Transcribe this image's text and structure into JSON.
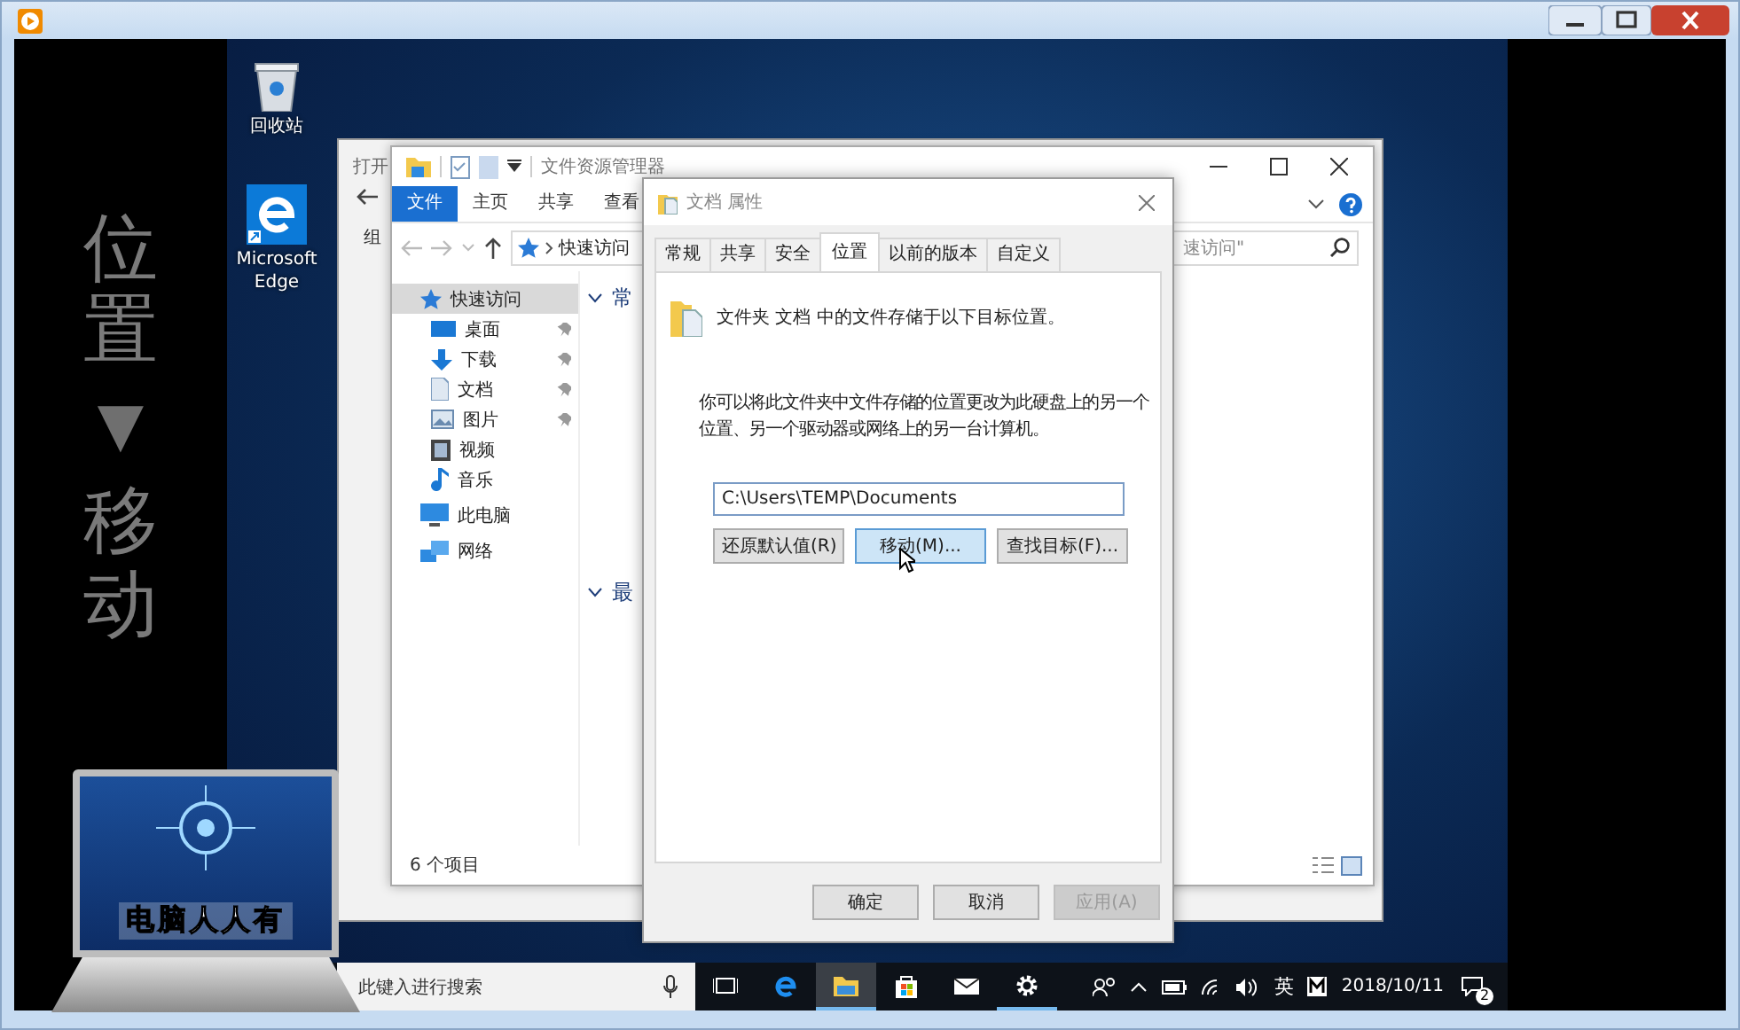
{
  "caption": {
    "top": "位置",
    "arrow": "▼",
    "bottom": "移动"
  },
  "desktop_icons": [
    {
      "kind": "recycle-bin",
      "label": "回收站"
    },
    {
      "kind": "edge",
      "label": "Microsoft Edge"
    }
  ],
  "back_window": {
    "title": "打开",
    "toolbar_text": "组"
  },
  "explorer": {
    "title": "文件资源管理器",
    "ribbon_tabs": [
      {
        "label": "文件",
        "selected": true
      },
      {
        "label": "主页",
        "selected": false
      },
      {
        "label": "共享",
        "selected": false
      },
      {
        "label": "查看",
        "selected": false
      }
    ],
    "address": "快速访问",
    "search_placeholder": "速访问\"",
    "nav": [
      {
        "kind": "star",
        "label": "快速访问",
        "selected": true,
        "children": [
          {
            "kind": "desktop",
            "label": "桌面",
            "pinned": true
          },
          {
            "kind": "download",
            "label": "下载",
            "pinned": true
          },
          {
            "kind": "document",
            "label": "文档",
            "pinned": true
          },
          {
            "kind": "picture",
            "label": "图片",
            "pinned": true
          },
          {
            "kind": "video",
            "label": "视频",
            "pinned": false
          },
          {
            "kind": "music",
            "label": "音乐",
            "pinned": false
          }
        ]
      },
      {
        "kind": "pc",
        "label": "此电脑",
        "selected": false
      },
      {
        "kind": "network",
        "label": "网络",
        "selected": false
      }
    ],
    "sections": [
      {
        "label": "常",
        "expanded": true
      },
      {
        "label": "最",
        "expanded": true
      }
    ],
    "status": "6 个项目"
  },
  "dialog": {
    "title": "文档 属性",
    "tabs": [
      {
        "label": "常规",
        "selected": false
      },
      {
        "label": "共享",
        "selected": false
      },
      {
        "label": "安全",
        "selected": false
      },
      {
        "label": "位置",
        "selected": true
      },
      {
        "label": "以前的版本",
        "selected": false
      },
      {
        "label": "自定义",
        "selected": false
      }
    ],
    "summary": "文件夹 文档 中的文件存储于以下目标位置。",
    "description": "你可以将此文件夹中文件存储的位置更改为此硬盘上的另一个位置、另一个驱动器或网络上的另一台计算机。",
    "path": "C:\\Users\\TEMP\\Documents",
    "actions": [
      {
        "label": "还原默认值(R)",
        "hover": false
      },
      {
        "label": "移动(M)...",
        "hover": true
      },
      {
        "label": "查找目标(F)...",
        "hover": false
      }
    ],
    "buttons": [
      {
        "label": "确定",
        "disabled": false
      },
      {
        "label": "取消",
        "disabled": false
      },
      {
        "label": "应用(A)",
        "disabled": true
      }
    ]
  },
  "taskbar": {
    "search_placeholder": "此键入进行搜索",
    "apps": [
      {
        "kind": "task-view",
        "active": false,
        "running": false
      },
      {
        "kind": "edge",
        "active": false,
        "running": false
      },
      {
        "kind": "explorer",
        "active": true,
        "running": true
      },
      {
        "kind": "store",
        "active": false,
        "running": false
      },
      {
        "kind": "mail",
        "active": false,
        "running": false
      },
      {
        "kind": "settings",
        "active": false,
        "running": true
      }
    ],
    "ime": "英",
    "date": "2018/10/11",
    "notifications": "2"
  },
  "logo": {
    "text": "电脑人人有"
  }
}
